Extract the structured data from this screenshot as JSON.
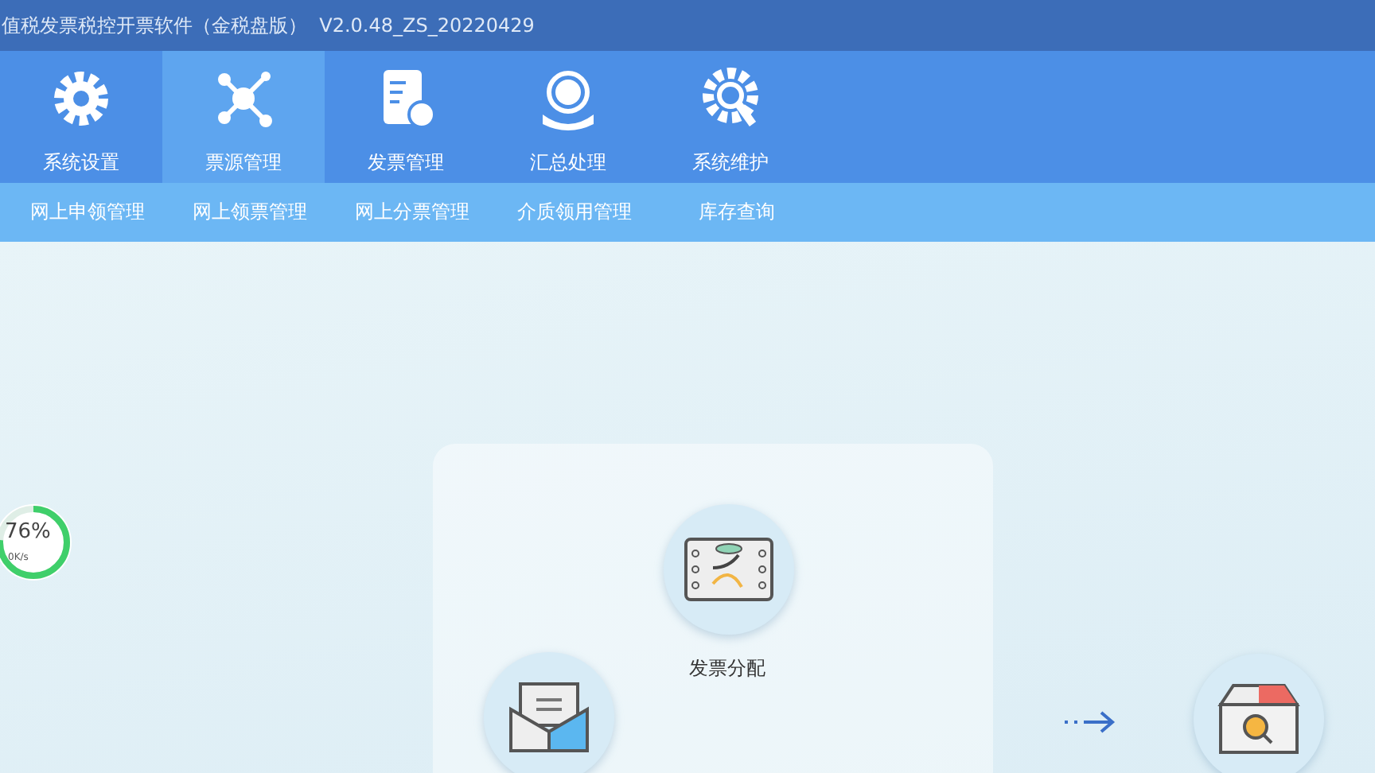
{
  "window": {
    "title": "值税发票税控开票软件（金税盘版）  V2.0.48_ZS_20220429"
  },
  "tabs": [
    {
      "kind": "gear",
      "label": "系统设置",
      "selected": false
    },
    {
      "kind": "network",
      "label": "票源管理",
      "selected": true
    },
    {
      "kind": "invoice",
      "label": "发票管理",
      "selected": false
    },
    {
      "kind": "tax",
      "label": "汇总处理",
      "selected": false
    },
    {
      "kind": "wrench",
      "label": "系统维护",
      "selected": false
    }
  ],
  "subtabs": [
    {
      "label": "网上申领管理"
    },
    {
      "label": "网上领票管理"
    },
    {
      "label": "网上分票管理"
    },
    {
      "label": "介质领用管理"
    },
    {
      "label": "库存查询"
    }
  ],
  "speed_widget": {
    "level": 0.76,
    "percent": "76%",
    "rate": "0K/s"
  },
  "flow_nodes": [
    {
      "kind": "distribute",
      "label": "发票分配"
    },
    {
      "kind": "envelope"
    },
    {
      "kind": "arrow"
    },
    {
      "kind": "inventory"
    }
  ]
}
